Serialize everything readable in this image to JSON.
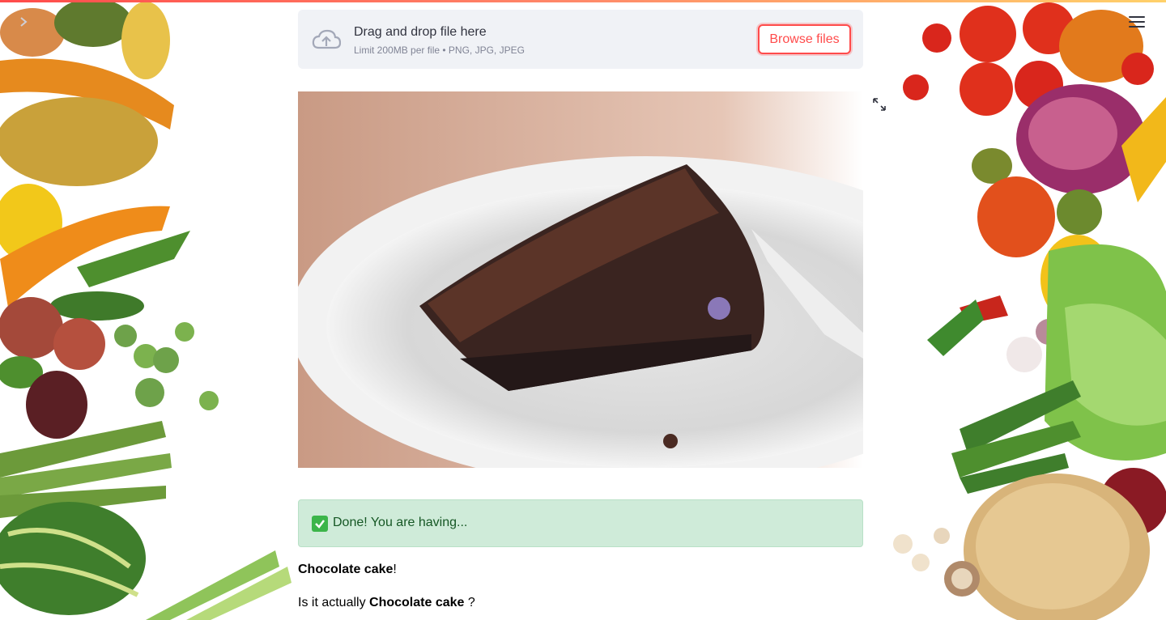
{
  "colors": {
    "accent": "#ff4b4b",
    "uploader_bg": "#f0f2f6",
    "success_bg": "#cfebd9",
    "success_text": "#155724"
  },
  "icons": {
    "sidebar_toggle": "chevron-right-icon",
    "menu": "hamburger-menu-icon",
    "upload": "cloud-upload-icon",
    "fullscreen": "expand-icon",
    "success": "check-mark-icon"
  },
  "uploader": {
    "title": "Drag and drop file here",
    "limit": "Limit 200MB per file • PNG, JPG, JPEG",
    "button_label": "Browse files"
  },
  "image": {
    "alt": "Chocolate cake"
  },
  "alert": {
    "text": "Done! You are having..."
  },
  "result": {
    "prediction": "Chocolate cake",
    "suffix": "!",
    "question_prefix": "Is it actually ",
    "question_prediction": "Chocolate cake",
    "question_suffix": " ?"
  }
}
